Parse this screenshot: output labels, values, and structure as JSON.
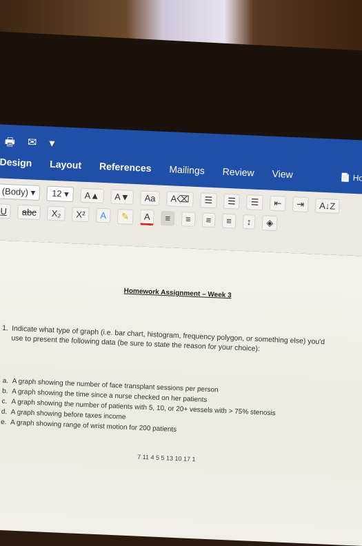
{
  "ribbon": {
    "qat": [
      {
        "icon": "print-icon"
      },
      {
        "icon": "email-icon"
      },
      {
        "icon": "customize-dropdown-icon"
      }
    ],
    "tabs": [
      "Design",
      "Layout",
      "References",
      "Mailings",
      "Review",
      "View"
    ],
    "doc_name": "Hom",
    "font_name": "(Body)",
    "font_size": "12",
    "row1_buttons": [
      "A▲",
      "A▼",
      "Aa",
      "A⌫",
      "☰",
      "☰",
      "☰",
      "⇤",
      "⇥",
      "A↓Z",
      "¶"
    ],
    "row2_buttons": [
      "U",
      "abc",
      "X₂",
      "X²",
      "A",
      "✎",
      "A",
      "≡",
      "≡",
      "≡",
      "≡",
      "↕",
      "◈"
    ]
  },
  "document": {
    "title": "Homework Assignment – Week 3",
    "question_number": "1.",
    "question_text": "Indicate what type of graph (i.e. bar chart, histogram, frequency polygon, or something else) you'd use to present the following data (be sure to state the reason for your choice):",
    "items": [
      {
        "label": "a.",
        "text": "A graph showing the number of face transplant sessions per person"
      },
      {
        "label": "b.",
        "text": "A graph showing the time since a nurse checked on her patients"
      },
      {
        "label": "c.",
        "text": "A graph showing the number of patients with 5, 10, or 20+ vessels with > 75% stenosis"
      },
      {
        "label": "d.",
        "text": "A graph showing before taxes income"
      },
      {
        "label": "e.",
        "text": "A graph showing range of wrist motion for 200 patients"
      }
    ],
    "partial_bottom_text": "7 11 4 5 5 13 10 17 1"
  }
}
